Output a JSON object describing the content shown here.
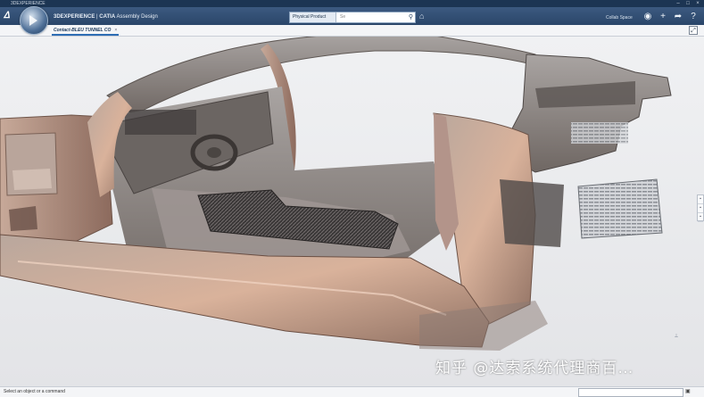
{
  "window": {
    "title": "3DEXPERIENCE"
  },
  "app": {
    "brand": "3DEXPERIENCE",
    "separator": " | ",
    "product": "CATIA",
    "module": "Assembly Design"
  },
  "search": {
    "scope": "Physical Product",
    "placeholder": "Se",
    "icon": "search-icon"
  },
  "collab_space": "Collab Space",
  "tabs": [
    {
      "label": "Contact-BLEU TUNNEL CO",
      "close": "×"
    }
  ],
  "status": {
    "message": "Select an object or a command"
  },
  "watermark": "知乎 @达索系统代理商百…",
  "colors": {
    "topbar": "#2a4669",
    "accent": "#2e6db4",
    "model": "#c9a58f"
  }
}
